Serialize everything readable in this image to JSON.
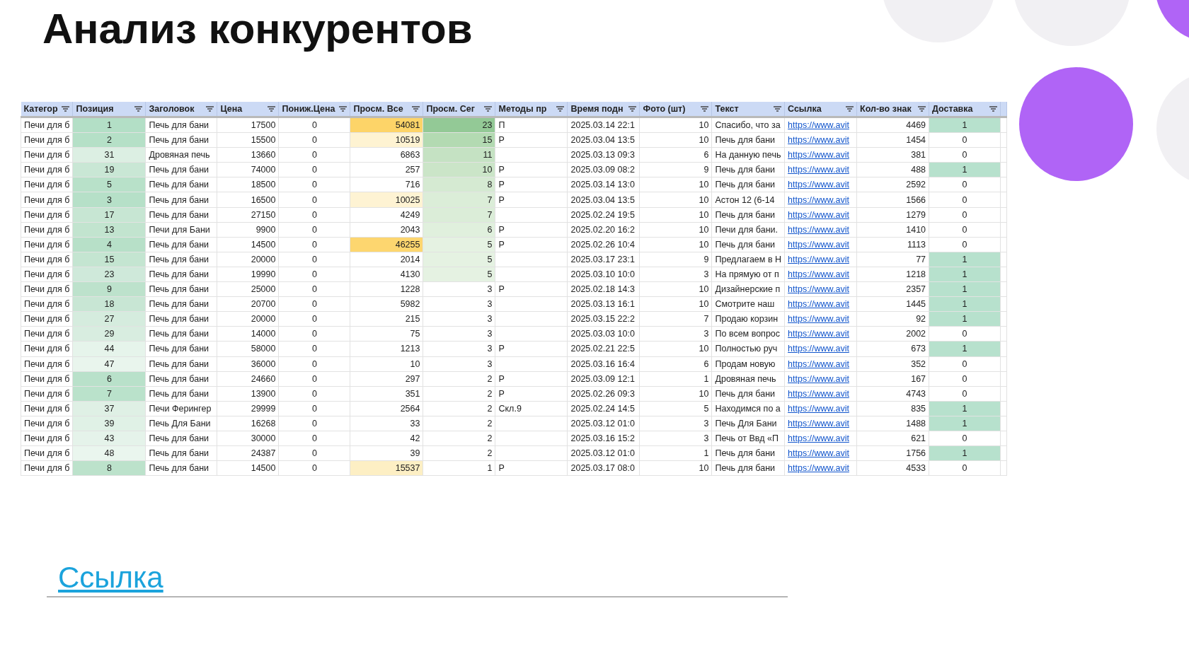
{
  "title": "Анализ конкурентов",
  "table": {
    "columns": [
      "Категор",
      "Позиция",
      "Заголовок",
      "Цена",
      "Пониж.Цена",
      "Просм. Все",
      "Просм. Сег",
      "Методы пр",
      "Время подн",
      "Фото (шт)",
      "Текст",
      "Ссылка",
      "Кол-во знак",
      "Доставка"
    ],
    "rows": [
      {
        "category": "Печи для б",
        "position": {
          "text": "1",
          "color": "#b3dfc6"
        },
        "title": "Печь для бани",
        "price": "17500",
        "price_drop": "0",
        "views_total": {
          "text": "54081",
          "color": "#fdd468"
        },
        "views_today": {
          "text": "23",
          "color": "#93c996"
        },
        "promo": "П",
        "posted": "2025.03.14 22:1",
        "photos": "10",
        "text": "Спасибо, что за",
        "link": "https://www.avit",
        "chars": "4469",
        "delivery": {
          "text": "1",
          "color": "#b7e1cd"
        }
      },
      {
        "category": "Печи для б",
        "position": {
          "text": "2",
          "color": "#b5e0c7"
        },
        "title": "Печь для бани",
        "price": "15500",
        "price_drop": "0",
        "views_total": {
          "text": "10519",
          "color": "#fef3d2"
        },
        "views_today": {
          "text": "15",
          "color": "#b3dab2"
        },
        "promo": "Р",
        "posted": "2025.03.04 13:5",
        "photos": "10",
        "text": "Печь для бани",
        "link": "https://www.avit",
        "chars": "1454",
        "delivery": "0"
      },
      {
        "category": "Печи для б",
        "position": {
          "text": "31",
          "color": "#dcefe3"
        },
        "title": "Дровяная печь",
        "price": "13660",
        "price_drop": "0",
        "views_total": "6863",
        "views_today": {
          "text": "11",
          "color": "#c5e2c3"
        },
        "posted": "2025.03.13 09:3",
        "photos": "6",
        "text": "На данную печь",
        "link": "https://www.avit",
        "chars": "381",
        "delivery": "0"
      },
      {
        "category": "Печи для б",
        "position": {
          "text": "19",
          "color": "#c9e7d5"
        },
        "title": "Печь для бани",
        "price": "74000",
        "price_drop": "0",
        "views_total": "257",
        "views_today": {
          "text": "10",
          "color": "#cbe5c8"
        },
        "promo": "Р",
        "posted": "2025.03.09 08:2",
        "photos": "9",
        "text": "Печь для бани",
        "link": "https://www.avit",
        "chars": "488",
        "delivery": {
          "text": "1",
          "color": "#b7e1cd"
        }
      },
      {
        "category": "Печи для б",
        "position": {
          "text": "5",
          "color": "#b8e1c9"
        },
        "title": "Печь для бани",
        "price": "18500",
        "price_drop": "0",
        "views_total": "716",
        "views_today": {
          "text": "8",
          "color": "#d5ead2"
        },
        "promo": "Р",
        "posted": "2025.03.14 13:0",
        "photos": "10",
        "text": "Печь для бани",
        "link": "https://www.avit",
        "chars": "2592",
        "delivery": "0"
      },
      {
        "category": "Печи для б",
        "position": {
          "text": "3",
          "color": "#b6e0c8"
        },
        "title": "Печь для бани",
        "price": "16500",
        "price_drop": "0",
        "views_total": {
          "text": "10025",
          "color": "#fef3d3"
        },
        "views_today": {
          "text": "7",
          "color": "#dbedd8"
        },
        "promo": "Р",
        "posted": "2025.03.04 13:5",
        "photos": "10",
        "text": "Астон 12 (6-14",
        "link": "https://www.avit",
        "chars": "1566",
        "delivery": "0"
      },
      {
        "category": "Печи для б",
        "position": {
          "text": "17",
          "color": "#c7e6d3"
        },
        "title": "Печь для бани",
        "price": "27150",
        "price_drop": "0",
        "views_total": "4249",
        "views_today": {
          "text": "7",
          "color": "#dbedd8"
        },
        "posted": "2025.02.24 19:5",
        "photos": "10",
        "text": "Печь для бани",
        "link": "https://www.avit",
        "chars": "1279",
        "delivery": "0"
      },
      {
        "category": "Печи для б",
        "position": {
          "text": "13",
          "color": "#c2e4cf"
        },
        "title": "Печи для Бани",
        "price": "9900",
        "price_drop": "0",
        "views_total": "2043",
        "views_today": {
          "text": "6",
          "color": "#e0f0dd"
        },
        "promo": "Р",
        "posted": "2025.02.20 16:2",
        "photos": "10",
        "text": "Печи для бани.",
        "link": "https://www.avit",
        "chars": "1410",
        "delivery": "0"
      },
      {
        "category": "Печи для б",
        "position": {
          "text": "4",
          "color": "#b7e0c8"
        },
        "title": "Печь для бани",
        "price": "14500",
        "price_drop": "0",
        "views_total": {
          "text": "46255",
          "color": "#fdd66f"
        },
        "views_today": {
          "text": "5",
          "color": "#e5f2e2"
        },
        "promo": "Р",
        "posted": "2025.02.26 10:4",
        "photos": "10",
        "text": "Печь для бани",
        "link": "https://www.avit",
        "chars": "1113",
        "delivery": "0"
      },
      {
        "category": "Печи для б",
        "position": {
          "text": "15",
          "color": "#c4e5d1"
        },
        "title": "Печь для бани",
        "price": "20000",
        "price_drop": "0",
        "views_total": "2014",
        "views_today": {
          "text": "5",
          "color": "#e5f2e2"
        },
        "posted": "2025.03.17 23:1",
        "photos": "9",
        "text": "Предлагаем в Н",
        "link": "https://www.avit",
        "chars": "77",
        "delivery": {
          "text": "1",
          "color": "#b7e1cd"
        }
      },
      {
        "category": "Печи для б",
        "position": {
          "text": "23",
          "color": "#cfe9da"
        },
        "title": "Печь для бани",
        "price": "19990",
        "price_drop": "0",
        "views_total": "4130",
        "views_today": {
          "text": "5",
          "color": "#e5f2e2"
        },
        "posted": "2025.03.10 10:0",
        "photos": "3",
        "text": "На прямую от п",
        "link": "https://www.avit",
        "chars": "1218",
        "delivery": {
          "text": "1",
          "color": "#b7e1cd"
        }
      },
      {
        "category": "Печи для б",
        "position": {
          "text": "9",
          "color": "#bde2cc"
        },
        "title": "Печь для бани",
        "price": "25000",
        "price_drop": "0",
        "views_total": "1228",
        "views_today": "3",
        "promo": "Р",
        "posted": "2025.02.18 14:3",
        "photos": "10",
        "text": "Дизайнерские п",
        "link": "https://www.avit",
        "chars": "2357",
        "delivery": {
          "text": "1",
          "color": "#b7e1cd"
        }
      },
      {
        "category": "Печи для б",
        "position": {
          "text": "18",
          "color": "#c8e6d4"
        },
        "title": "Печь для бани",
        "price": "20700",
        "price_drop": "0",
        "views_total": "5982",
        "views_today": "3",
        "posted": "2025.03.13 16:1",
        "photos": "10",
        "text": "Смотрите наш",
        "link": "https://www.avit",
        "chars": "1445",
        "delivery": {
          "text": "1",
          "color": "#b7e1cd"
        }
      },
      {
        "category": "Печи для б",
        "position": {
          "text": "27",
          "color": "#d5ecde"
        },
        "title": "Печь для бани",
        "price": "20000",
        "price_drop": "0",
        "views_total": "215",
        "views_today": "3",
        "posted": "2025.03.15 22:2",
        "photos": "7",
        "text": "Продаю корзин",
        "link": "https://www.avit",
        "chars": "92",
        "delivery": {
          "text": "1",
          "color": "#b7e1cd"
        }
      },
      {
        "category": "Печи для б",
        "position": {
          "text": "29",
          "color": "#d8ede0"
        },
        "title": "Печь для бани",
        "price": "14000",
        "price_drop": "0",
        "views_total": "75",
        "views_today": "3",
        "posted": "2025.03.03 10:0",
        "photos": "3",
        "text": "По всем вопрос",
        "link": "https://www.avit",
        "chars": "2002",
        "delivery": "0"
      },
      {
        "category": "Печи для б",
        "position": {
          "text": "44",
          "color": "#e6f4eb"
        },
        "title": "Печь для бани",
        "price": "58000",
        "price_drop": "0",
        "views_total": "1213",
        "views_today": "3",
        "promo": "Р",
        "posted": "2025.02.21 22:5",
        "photos": "10",
        "text": "Полностью руч",
        "link": "https://www.avit",
        "chars": "673",
        "delivery": {
          "text": "1",
          "color": "#b7e1cd"
        }
      },
      {
        "category": "Печи для б",
        "position": {
          "text": "47",
          "color": "#e9f5ed"
        },
        "title": "Печь для бани",
        "price": "36000",
        "price_drop": "0",
        "views_total": "10",
        "views_today": "3",
        "posted": "2025.03.16 16:4",
        "photos": "6",
        "text": "Продам новую",
        "link": "https://www.avit",
        "chars": "352",
        "delivery": "0"
      },
      {
        "category": "Печи для б",
        "position": {
          "text": "6",
          "color": "#b9e1ca"
        },
        "title": "Печь для бани",
        "price": "24660",
        "price_drop": "0",
        "views_total": "297",
        "views_today": "2",
        "promo": "Р",
        "posted": "2025.03.09 12:1",
        "photos": "1",
        "text": "Дровяная печь",
        "link": "https://www.avit",
        "chars": "167",
        "delivery": "0"
      },
      {
        "category": "Печи для б",
        "position": {
          "text": "7",
          "color": "#bae2cb"
        },
        "title": "Печь для бани",
        "price": "13900",
        "price_drop": "0",
        "views_total": "351",
        "views_today": "2",
        "promo": "Р",
        "posted": "2025.02.26 09:3",
        "photos": "10",
        "text": "Печь для бани",
        "link": "https://www.avit",
        "chars": "4743",
        "delivery": "0"
      },
      {
        "category": "Печи для б",
        "position": {
          "text": "37",
          "color": "#dff0e5"
        },
        "title": "Печи Ферингер",
        "price": "29999",
        "price_drop": "0",
        "views_total": "2564",
        "views_today": "2",
        "promo": "Скл.9",
        "posted": "2025.02.24 14:5",
        "photos": "5",
        "text": "Находимся по а",
        "link": "https://www.avit",
        "chars": "835",
        "delivery": {
          "text": "1",
          "color": "#b7e1cd"
        }
      },
      {
        "category": "Печи для б",
        "position": {
          "text": "39",
          "color": "#e0f1e6"
        },
        "title": "Печь Для Бани",
        "price": "16268",
        "price_drop": "0",
        "views_total": "33",
        "views_today": "2",
        "posted": "2025.03.12 01:0",
        "photos": "3",
        "text": "Печь Для Бани",
        "link": "https://www.avit",
        "chars": "1488",
        "delivery": {
          "text": "1",
          "color": "#b7e1cd"
        }
      },
      {
        "category": "Печи для б",
        "position": {
          "text": "43",
          "color": "#e5f3ea"
        },
        "title": "Печь для бани",
        "price": "30000",
        "price_drop": "0",
        "views_total": "42",
        "views_today": "2",
        "posted": "2025.03.16 15:2",
        "photos": "3",
        "text": "Печь от Ввд «П",
        "link": "https://www.avit",
        "chars": "621",
        "delivery": "0"
      },
      {
        "category": "Печи для б",
        "position": {
          "text": "48",
          "color": "#eaf6ee"
        },
        "title": "Печь для бани",
        "price": "24387",
        "price_drop": "0",
        "views_total": "39",
        "views_today": "2",
        "posted": "2025.03.12 01:0",
        "photos": "1",
        "text": "Печь для бани",
        "link": "https://www.avit",
        "chars": "1756",
        "delivery": {
          "text": "1",
          "color": "#b7e1cd"
        }
      },
      {
        "category": "Печи для б",
        "position": {
          "text": "8",
          "color": "#bce2cb"
        },
        "title": "Печь для бани",
        "price": "14500",
        "price_drop": "0",
        "views_total": {
          "text": "15537",
          "color": "#fdefc4"
        },
        "views_today": "1",
        "promo": "Р",
        "posted": "2025.03.17 08:0",
        "photos": "10",
        "text": "Печь для бани",
        "link": "https://www.avit",
        "chars": "4533",
        "delivery": "0"
      }
    ]
  },
  "link": "Ссылка"
}
